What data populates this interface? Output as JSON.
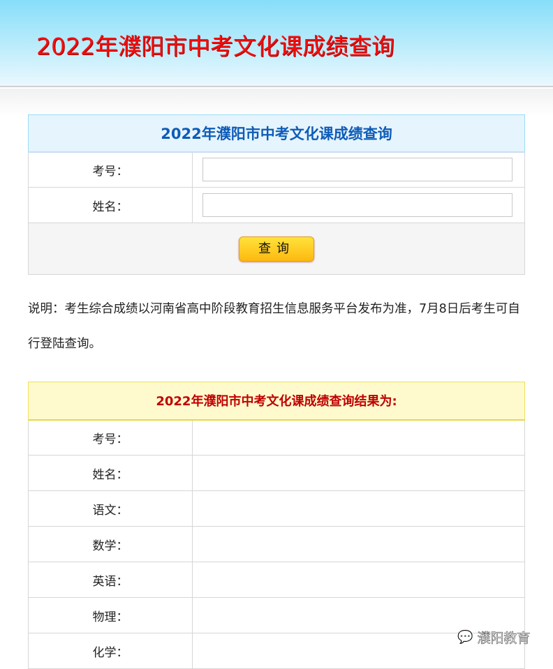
{
  "banner": {
    "title": "2022年濮阳市中考文化课成绩查询"
  },
  "form": {
    "title": "2022年濮阳市中考文化课成绩查询",
    "fields": [
      {
        "label": "考号：",
        "value": ""
      },
      {
        "label": "姓名：",
        "value": ""
      }
    ],
    "submit": "查询"
  },
  "note": "说明：考生综合成绩以河南省高中阶段教育招生信息服务平台发布为准，7月8日后考生可自行登陆查询。",
  "result": {
    "title": "2022年濮阳市中考文化课成绩查询结果为:",
    "rows": [
      {
        "label": "考号：",
        "value": ""
      },
      {
        "label": "姓名：",
        "value": ""
      },
      {
        "label": "语文：",
        "value": ""
      },
      {
        "label": "数学：",
        "value": ""
      },
      {
        "label": "英语：",
        "value": ""
      },
      {
        "label": "物理：",
        "value": ""
      },
      {
        "label": "化学：",
        "value": ""
      }
    ]
  },
  "watermark": "濮阳教育"
}
